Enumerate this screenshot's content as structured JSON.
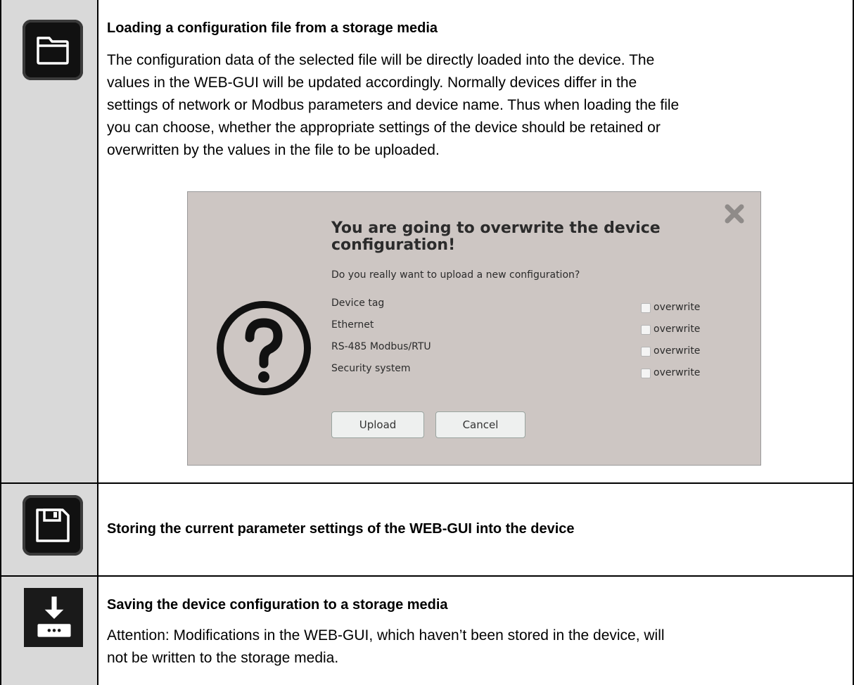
{
  "rows": [
    {
      "icon": "folder-open-icon",
      "heading": "Loading a configuration file from a storage media",
      "paragraph_lines": [
        "The configuration data of the selected file will be directly loaded into the device. The",
        "values in the WEB-GUI will be updated accordingly. Normally devices differ in the",
        "settings of network or Modbus parameters and device name. Thus when loading the file",
        "you can choose, whether the appropriate settings of the device should be retained or",
        "overwritten by the values in the file to be uploaded."
      ]
    },
    {
      "icon": "floppy-disk-icon",
      "heading": "Storing the current parameter settings of the WEB-GUI into the device"
    },
    {
      "icon": "download-to-device-icon",
      "heading": "Saving the device configuration to a storage media",
      "paragraph_lines": [
        "Attention: Modifications in the WEB-GUI, which haven’t been stored in the device, will",
        "not be written to the storage media."
      ]
    }
  ],
  "dialog": {
    "title_lines": [
      "You are going to overwrite the device",
      "configuration!"
    ],
    "subtitle": "Do you really want to upload a new configuration?",
    "options": [
      {
        "label": "Device tag",
        "checkbox_label": "overwrite",
        "checked": false
      },
      {
        "label": "Ethernet",
        "checkbox_label": "overwrite",
        "checked": false
      },
      {
        "label": "RS-485 Modbus/RTU",
        "checkbox_label": "overwrite",
        "checked": false
      },
      {
        "label": "Security system",
        "checkbox_label": "overwrite",
        "checked": false
      }
    ],
    "upload_label": "Upload",
    "cancel_label": "Cancel",
    "close_icon": "close-x-icon",
    "question_icon": "question-circle-icon",
    "background_color": "#cdc6c3"
  }
}
